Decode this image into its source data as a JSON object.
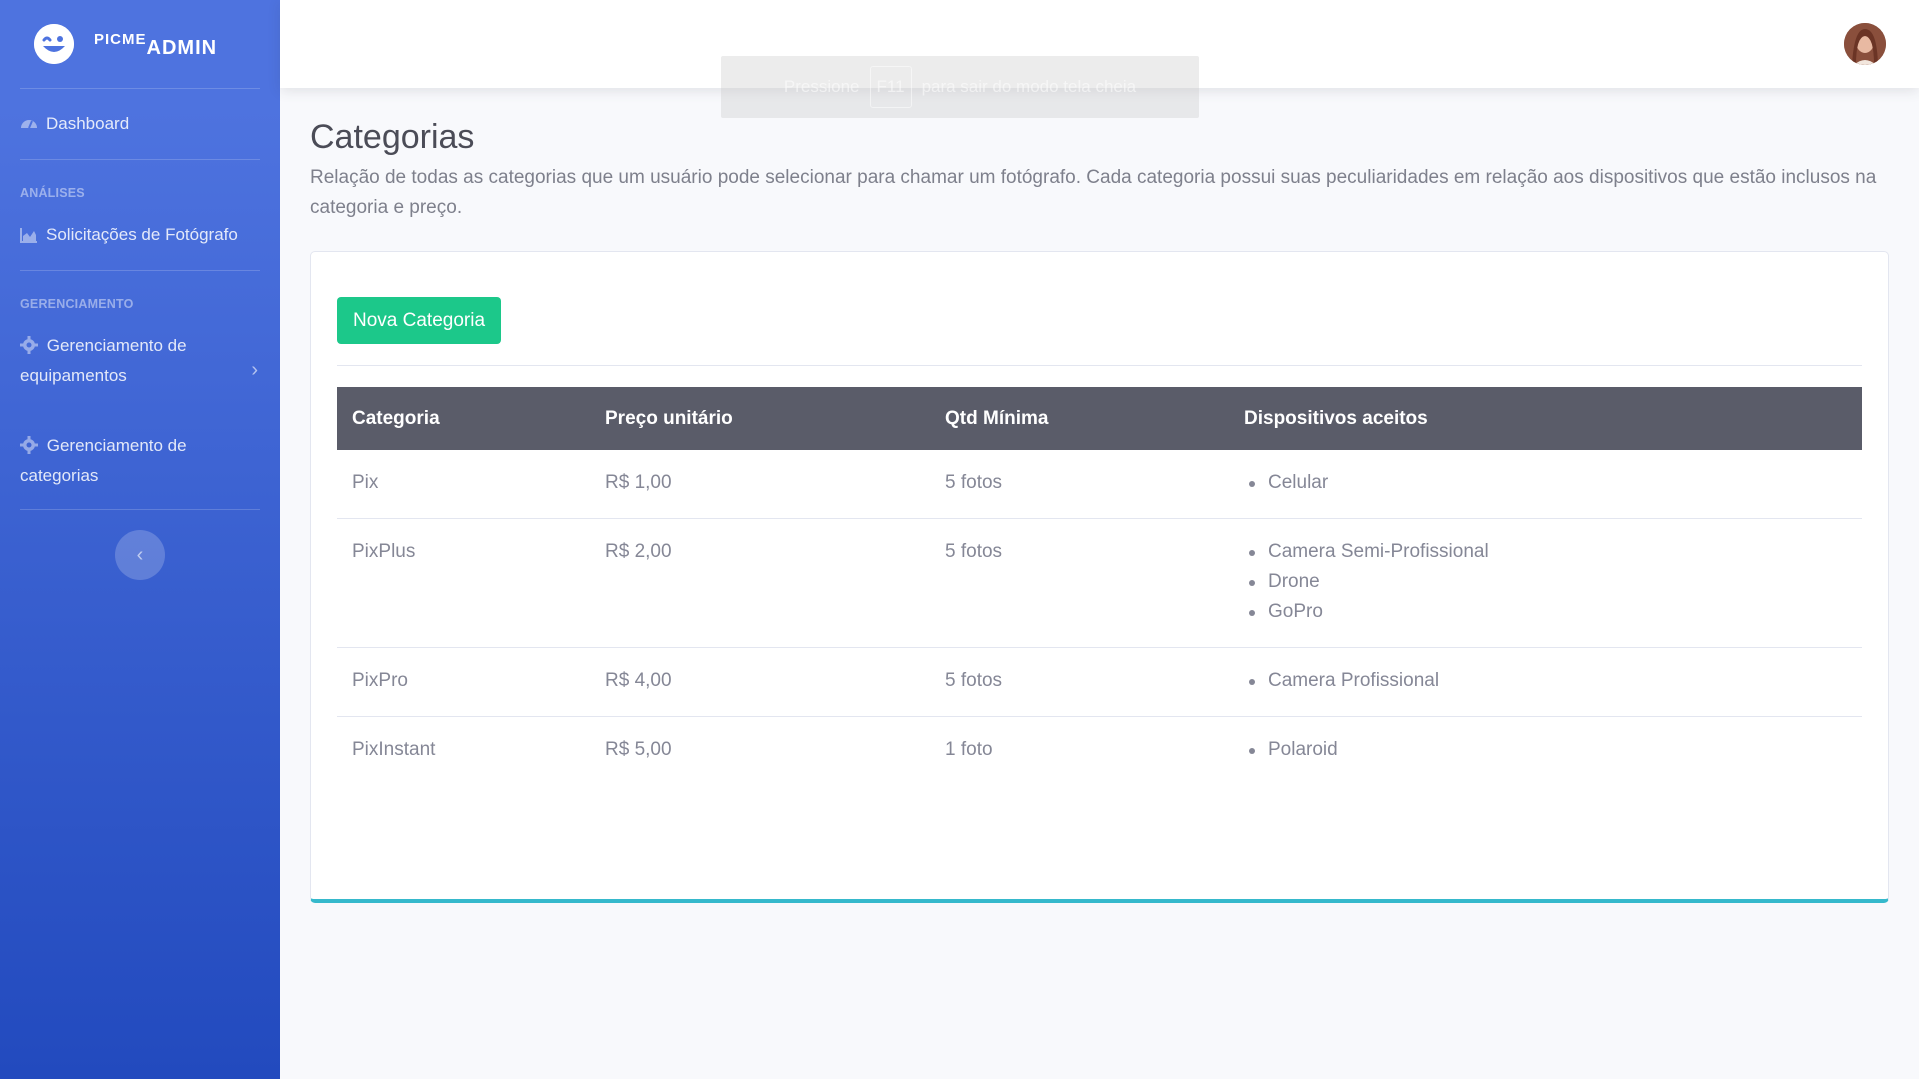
{
  "brand": {
    "small": "PICME",
    "big": "ADMIN"
  },
  "sidebar": {
    "dashboard": "Dashboard",
    "section_analises": "ANÁLISES",
    "solicitacoes": "Solicitações de Fotógrafo",
    "section_gerenciamento": "GERENCIAMENTO",
    "gerenciamento_equip_line1": "Gerenciamento de",
    "gerenciamento_equip_line2": "equipamentos",
    "gerenciamento_cat_line1": "Gerenciamento de",
    "gerenciamento_cat_line2": "categorias"
  },
  "fullscreen_notice": {
    "before": "Pressione",
    "key": "F11",
    "after": "para sair do modo tela cheia"
  },
  "page": {
    "title": "Categorias",
    "description": "Relação de todas as categorias que um usuário pode selecionar para chamar um fotógrafo. Cada categoria possui suas peculiaridades em relação aos dispositivos que estão inclusos na categoria e preço."
  },
  "new_button": "Nova Categoria",
  "table": {
    "headers": [
      "Categoria",
      "Preço unitário",
      "Qtd Mínima",
      "Dispositivos aceitos"
    ],
    "rows": [
      {
        "categoria": "Pix",
        "preco": "R$ 1,00",
        "qtd": "5 fotos",
        "dispositivos": [
          "Celular"
        ]
      },
      {
        "categoria": "PixPlus",
        "preco": "R$ 2,00",
        "qtd": "5 fotos",
        "dispositivos": [
          "Camera Semi-Profissional",
          "Drone",
          "GoPro"
        ]
      },
      {
        "categoria": "PixPro",
        "preco": "R$ 4,00",
        "qtd": "5 fotos",
        "dispositivos": [
          "Camera Profissional"
        ]
      },
      {
        "categoria": "PixInstant",
        "preco": "R$ 5,00",
        "qtd": "1 foto",
        "dispositivos": [
          "Polaroid"
        ]
      }
    ]
  },
  "colors": {
    "sidebar_top": "#4e73df",
    "sidebar_bottom": "#224abe",
    "success": "#1cc88a",
    "table_header": "#5a5c69",
    "card_border_accent": "#36b9cc"
  }
}
